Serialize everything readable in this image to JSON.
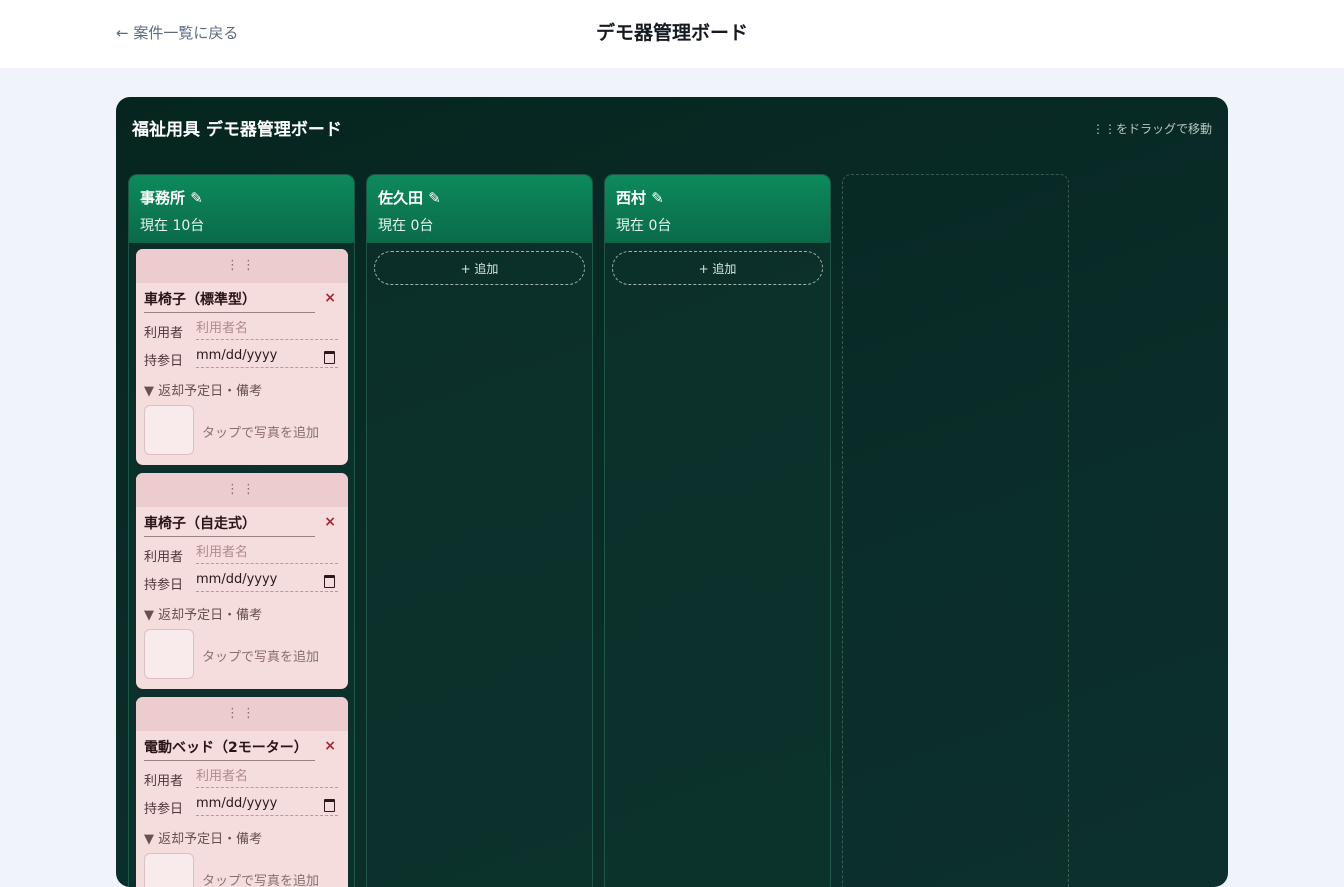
{
  "header": {
    "back_label": "← 案件一覧に戻る",
    "title": "デモ器管理ボード"
  },
  "board": {
    "title": "福祉用具 デモ器管理ボード",
    "drag_hint": "⋮⋮をドラッグで移動"
  },
  "columns": [
    {
      "name": "事務所 ✎",
      "count": "現在 10台",
      "cards": [
        {
          "grip": "⋮⋮",
          "title": "車椅子（標準型）",
          "close": "×",
          "user_label": "利用者",
          "user_placeholder": "利用者名",
          "date_label": "持参日",
          "date_value": "mm/dd/yyyy",
          "details_label": "▼ 返却予定日・備考",
          "photo_hint": "タップで写真を追加"
        },
        {
          "grip": "⋮⋮",
          "title": "車椅子（自走式）",
          "close": "×",
          "user_label": "利用者",
          "user_placeholder": "利用者名",
          "date_label": "持参日",
          "date_value": "mm/dd/yyyy",
          "details_label": "▼ 返却予定日・備考",
          "photo_hint": "タップで写真を追加"
        },
        {
          "grip": "⋮⋮",
          "title": "電動ベッド（2モーター）",
          "close": "×",
          "user_label": "利用者",
          "user_placeholder": "利用者名",
          "date_label": "持参日",
          "date_value": "mm/dd/yyyy",
          "details_label": "▼ 返却予定日・備考",
          "photo_hint": "タップで写真を追加"
        }
      ]
    },
    {
      "name": "佐久田 ✎",
      "count": "現在 0台",
      "add_label": "+ 追加"
    },
    {
      "name": "西村 ✎",
      "count": "現在 0台",
      "add_label": "+ 追加"
    }
  ]
}
